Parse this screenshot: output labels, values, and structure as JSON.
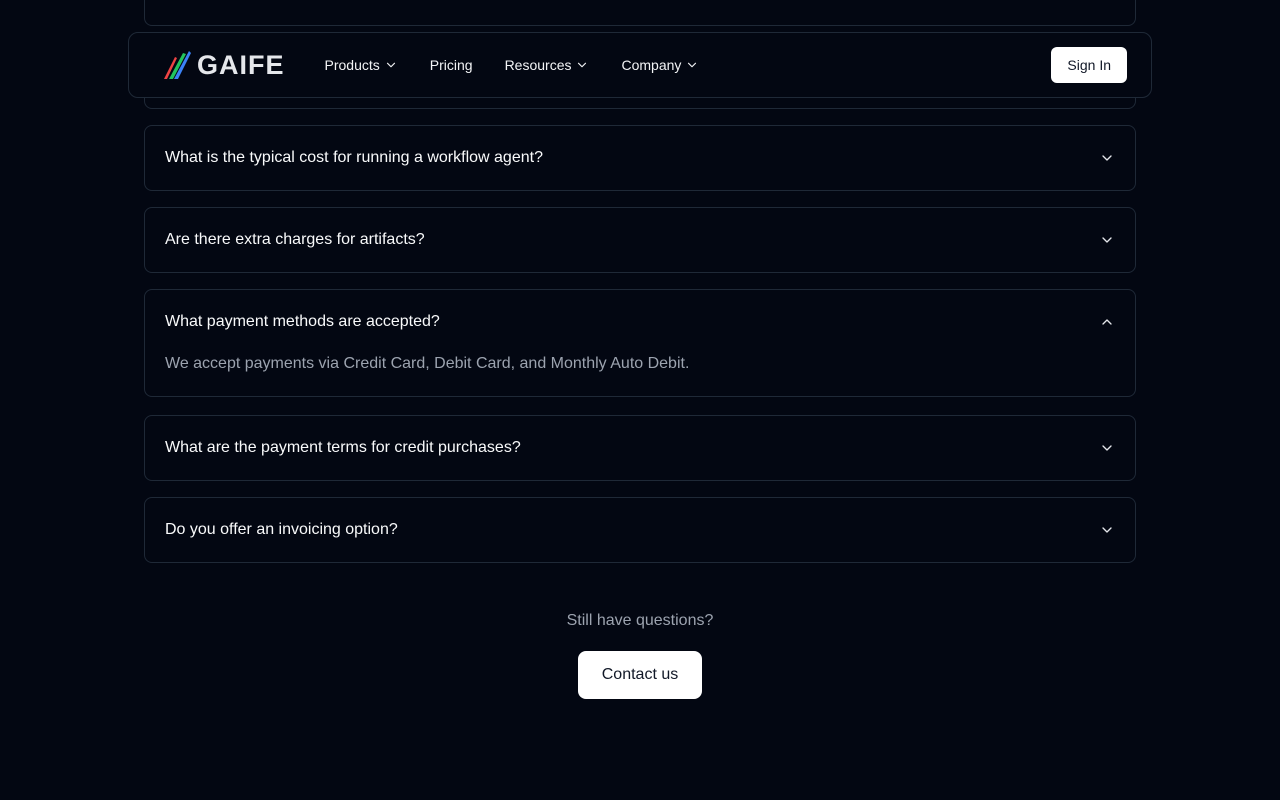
{
  "brand": {
    "name": "GAIFE"
  },
  "nav": {
    "products": "Products",
    "pricing": "Pricing",
    "resources": "Resources",
    "company": "Company",
    "sign_in": "Sign In"
  },
  "faq": [
    {
      "question": "What is the typical cost for running a workflow agent?",
      "expanded": false
    },
    {
      "question": "Are there extra charges for artifacts?",
      "expanded": false
    },
    {
      "question": "What payment methods are accepted?",
      "expanded": true,
      "answer": "We accept payments via Credit Card, Debit Card, and Monthly Auto Debit."
    },
    {
      "question": "What are the payment terms for credit purchases?",
      "expanded": false
    },
    {
      "question": "Do you offer an invoicing option?",
      "expanded": false
    }
  ],
  "cta": {
    "question": "Still have questions?",
    "button": "Contact us"
  },
  "icons": {
    "logo": "gaife-logo-mark",
    "chevron_down": "chevron-down-icon",
    "chevron_up": "chevron-up-icon"
  },
  "colors": {
    "background": "#030712",
    "border": "#1f2937",
    "muted_text": "#9ca3af",
    "button_bg": "#ffffff"
  }
}
